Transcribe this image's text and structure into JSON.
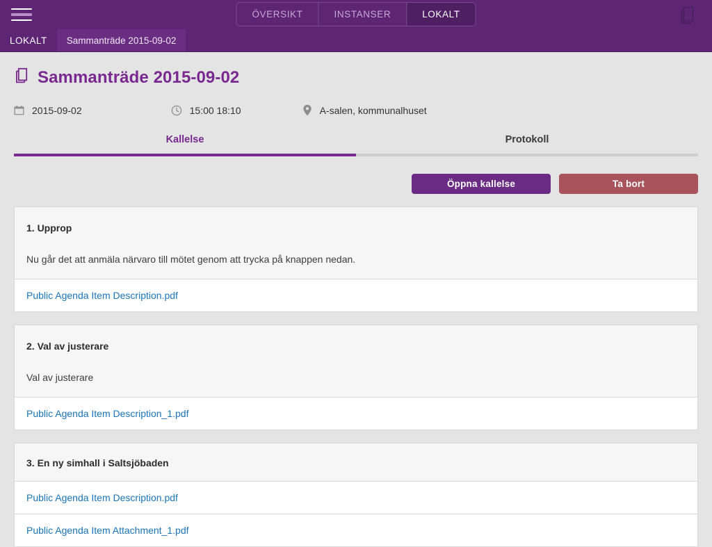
{
  "topbar": {
    "menu_icon": "hamburger-icon",
    "segments": [
      {
        "label": "ÖVERSIKT",
        "active": false
      },
      {
        "label": "INSTANSER",
        "active": false
      },
      {
        "label": "LOKALT",
        "active": true
      }
    ],
    "right_icon": "documents-copy-icon"
  },
  "breadcrumb": {
    "items": [
      {
        "label": "LOKALT"
      },
      {
        "label": "Sammanträde 2015-09-02"
      }
    ]
  },
  "page": {
    "title_icon": "documents-copy-icon",
    "title": "Sammanträde 2015-09-02",
    "meta": {
      "date_icon": "calendar-icon",
      "date": "2015-09-02",
      "time_icon": "clock-icon",
      "time": "15:00 18:10",
      "location_icon": "location-pin-icon",
      "location": "A-salen, kommunalhuset"
    }
  },
  "tabs": [
    {
      "label": "Kallelse",
      "active": true
    },
    {
      "label": "Protokoll",
      "active": false
    }
  ],
  "actions": {
    "open_label": "Öppna kallelse",
    "delete_label": "Ta bort"
  },
  "agenda": [
    {
      "title": "1. Upprop",
      "description": "Nu går det att anmäla närvaro till mötet genom att trycka på knappen nedan.",
      "attachments": [
        "Public Agenda Item Description.pdf"
      ]
    },
    {
      "title": "2. Val av justerare",
      "description": "Val av justerare",
      "attachments": [
        "Public Agenda Item Description_1.pdf"
      ]
    },
    {
      "title": "3. En ny simhall i Saltsjöbaden",
      "description": null,
      "attachments": [
        "Public Agenda Item Description.pdf",
        "Public Agenda Item Attachment_1.pdf"
      ]
    }
  ],
  "colors": {
    "brand_purple": "#5e2575",
    "accent_purple": "#79288f",
    "danger_red": "#a9545d",
    "link_blue": "#1a74b8",
    "page_bg": "#e4e4e4"
  }
}
